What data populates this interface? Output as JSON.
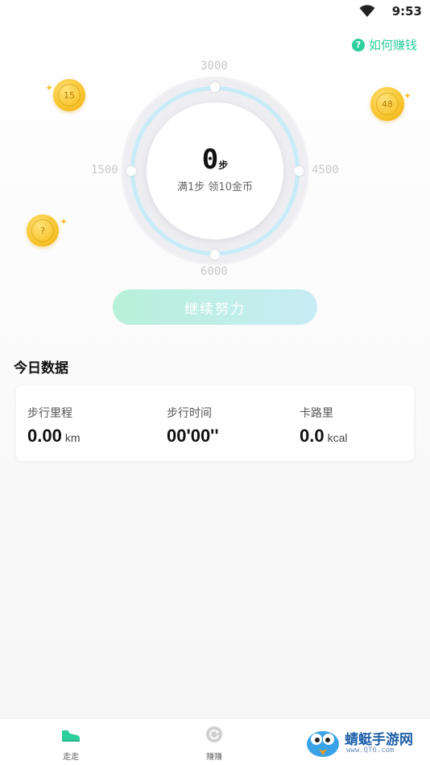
{
  "status_bar": {
    "time": "9:53",
    "wifi_icon": "wifi-icon"
  },
  "header": {
    "how_to_earn": "如何赚钱",
    "help_icon": "question-icon"
  },
  "dial": {
    "labels": {
      "top": "3000",
      "right": "4500",
      "bottom": "6000",
      "left": "1500"
    },
    "steps": "0",
    "steps_unit": "步",
    "hint": "满1步 领10金币"
  },
  "coins": [
    {
      "value": "15"
    },
    {
      "value": "48"
    },
    {
      "value": "?"
    }
  ],
  "continue_button": "继续努力",
  "today": {
    "title": "今日数据",
    "stats": [
      {
        "label": "步行里程",
        "value": "0.00",
        "unit": "km"
      },
      {
        "label": "步行时间",
        "value": "00'00''",
        "unit": ""
      },
      {
        "label": "卡路里",
        "value": "0.0",
        "unit": "kcal"
      }
    ]
  },
  "nav": {
    "items": [
      {
        "label": "走走",
        "icon": "shoe-icon"
      },
      {
        "label": "赚赚",
        "icon": "coin-refresh-icon"
      }
    ]
  },
  "watermark": {
    "text": "蜻蜓手游网",
    "url": "www.QT6.com"
  },
  "colors": {
    "accent": "#2ecf9c",
    "coin": "#f7c42c",
    "ring": "#c7ecf8"
  }
}
